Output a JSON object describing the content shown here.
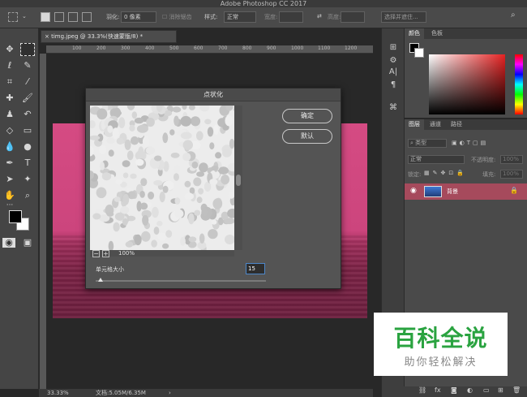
{
  "app": {
    "title": "Adobe Photoshop CC 2017"
  },
  "options": {
    "feather_label": "羽化:",
    "feather_value": "0 像素",
    "anti_alias_label": "消除锯齿",
    "style_label": "样式:",
    "style_value": "正常",
    "width_label": "宽度:",
    "height_label": "高度:",
    "select_subject_label": "选择并遮住..."
  },
  "document": {
    "tab_label": "timg.jpeg @ 33.3%(快速蒙版/8) *",
    "ruler_ticks": [
      "100",
      "200",
      "300",
      "400",
      "500",
      "600",
      "700",
      "800",
      "900",
      "1000",
      "1100",
      "1200"
    ]
  },
  "status": {
    "zoom": "33.33%",
    "doc_size": "文档:5.05M/6.35M"
  },
  "dialog": {
    "title": "点状化",
    "ok_label": "确定",
    "reset_label": "默认",
    "zoom_minus": "−",
    "zoom_plus": "+",
    "zoom_level": "100%",
    "cell_size_label": "单元格大小",
    "cell_size_value": "15",
    "cell_size_slider_fraction": 0.03
  },
  "color_panel": {
    "tabs": [
      "颜色",
      "色板"
    ]
  },
  "layers_panel": {
    "tabs": [
      "图层",
      "通道",
      "路径"
    ],
    "filter_placeholder": "类型",
    "blend_mode": "正常",
    "opacity_label": "不透明度:",
    "opacity_value": "100%",
    "lock_label": "锁定:",
    "fill_label": "填充:",
    "fill_value": "100%",
    "layers": [
      {
        "name": "背景",
        "locked": true
      }
    ]
  },
  "watermark": {
    "main": "百科全说",
    "sub": "助你轻松解决"
  },
  "colors": {
    "accent_layer": "#a64a5c",
    "watermark_green": "#2aa340"
  }
}
